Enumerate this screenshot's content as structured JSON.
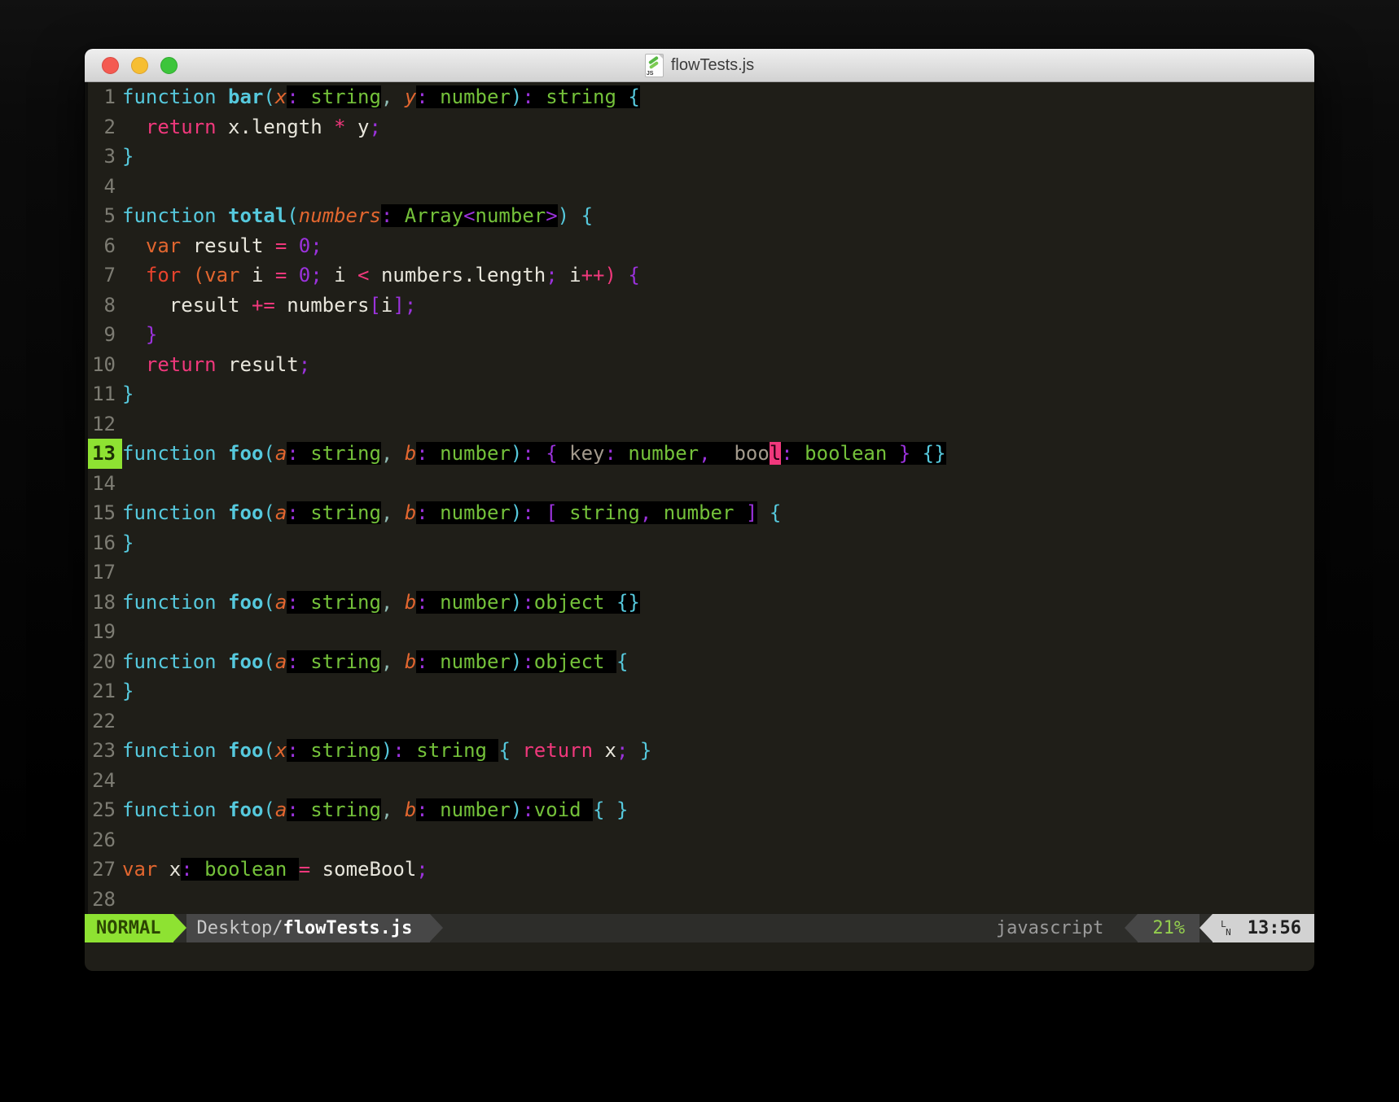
{
  "window": {
    "title": "flowTests.js"
  },
  "colors": {
    "code_background": "#1f1e18",
    "annotation_background": "#000000",
    "keyword_cyan": "#56c9dd",
    "type_green": "#74c13a",
    "param_orange": "#e2662f",
    "operator_pink": "#f0387c",
    "punct_purple": "#9b32dc",
    "identifier_white": "#e8e6dc",
    "mode_green": "#8ee232",
    "cursor_pink": "#f0387c"
  },
  "editor": {
    "current_line": 13,
    "lines": [
      {
        "n": 1,
        "toks": [
          [
            "cy",
            "function "
          ],
          [
            "cyb",
            "bar"
          ],
          [
            "cy",
            "("
          ],
          [
            "ori",
            "x"
          ],
          [
            "pu",
            ":",
            1
          ],
          [
            "gr",
            " string",
            1
          ],
          [
            "cm",
            ","
          ],
          [
            "wh",
            " "
          ],
          [
            "ori",
            "y"
          ],
          [
            "pu",
            ":",
            1
          ],
          [
            "gr",
            " number",
            1
          ],
          [
            "cy",
            ")",
            1
          ],
          [
            "pu",
            ":",
            1
          ],
          [
            "gr",
            " string",
            1
          ],
          [
            "cy",
            " {",
            1
          ]
        ]
      },
      {
        "n": 2,
        "toks": [
          [
            "pk",
            "  return"
          ],
          [
            "wh",
            " x.length"
          ],
          [
            "pk",
            " *"
          ],
          [
            "wh",
            " y"
          ],
          [
            "pu",
            ";"
          ]
        ]
      },
      {
        "n": 3,
        "toks": [
          [
            "cy",
            "}"
          ]
        ]
      },
      {
        "n": 4,
        "toks": []
      },
      {
        "n": 5,
        "toks": [
          [
            "cy",
            "function "
          ],
          [
            "cyb",
            "total"
          ],
          [
            "cy",
            "("
          ],
          [
            "ori",
            "numbers"
          ],
          [
            "pu",
            ":",
            1
          ],
          [
            "gr",
            " Array",
            1
          ],
          [
            "pu",
            "<",
            1
          ],
          [
            "gr",
            "number",
            1
          ],
          [
            "pu",
            ">",
            1
          ],
          [
            "cy",
            ") {"
          ]
        ]
      },
      {
        "n": 6,
        "toks": [
          [
            "or",
            "  var"
          ],
          [
            "wh",
            " result"
          ],
          [
            "pk",
            " ="
          ],
          [
            "pu",
            " 0;"
          ]
        ]
      },
      {
        "n": 7,
        "toks": [
          [
            "rd",
            "  for"
          ],
          [
            "or",
            " ("
          ],
          [
            "or",
            "var"
          ],
          [
            "wh",
            " i"
          ],
          [
            "pk",
            " ="
          ],
          [
            "pu",
            " 0;"
          ],
          [
            "wh",
            " i"
          ],
          [
            "pk",
            " <"
          ],
          [
            "wh",
            " numbers.length"
          ],
          [
            "pu",
            ";"
          ],
          [
            "wh",
            " i"
          ],
          [
            "pk",
            "++"
          ],
          [
            "pk",
            ")"
          ],
          [
            "pu",
            " {"
          ]
        ]
      },
      {
        "n": 8,
        "toks": [
          [
            "wh",
            "    result"
          ],
          [
            "pk",
            " +="
          ],
          [
            "wh",
            " numbers"
          ],
          [
            "pu",
            "["
          ],
          [
            "wh",
            "i"
          ],
          [
            "pu",
            "];"
          ]
        ]
      },
      {
        "n": 9,
        "toks": [
          [
            "pu",
            "  }"
          ]
        ]
      },
      {
        "n": 10,
        "toks": [
          [
            "pk",
            "  return"
          ],
          [
            "wh",
            " result"
          ],
          [
            "pu",
            ";"
          ]
        ]
      },
      {
        "n": 11,
        "toks": [
          [
            "cy",
            "}"
          ]
        ]
      },
      {
        "n": 12,
        "toks": []
      },
      {
        "n": 13,
        "toks": [
          [
            "cy",
            "function "
          ],
          [
            "cyb",
            "foo"
          ],
          [
            "cy",
            "("
          ],
          [
            "ori",
            "a"
          ],
          [
            "pu",
            ":",
            1
          ],
          [
            "gr",
            " string",
            1
          ],
          [
            "cm",
            ","
          ],
          [
            "wh",
            " "
          ],
          [
            "ori",
            "b"
          ],
          [
            "pu",
            ":",
            1
          ],
          [
            "gr",
            " number",
            1
          ],
          [
            "cy",
            ")",
            1
          ],
          [
            "pu",
            ":",
            1
          ],
          [
            "pu",
            " {",
            1
          ],
          [
            "gy",
            " key",
            1
          ],
          [
            "pu",
            ":",
            1
          ],
          [
            "gr",
            " number",
            1
          ],
          [
            "pu",
            ",",
            1
          ],
          [
            "gy",
            "  boo",
            1
          ],
          [
            "cur",
            "l"
          ],
          [
            "pu",
            ":",
            1
          ],
          [
            "gr",
            " boolean",
            1
          ],
          [
            "pu",
            " }",
            1
          ],
          [
            "wh",
            " ",
            1
          ],
          [
            "cy",
            "{}",
            1
          ]
        ]
      },
      {
        "n": 14,
        "toks": []
      },
      {
        "n": 15,
        "toks": [
          [
            "cy",
            "function "
          ],
          [
            "cyb",
            "foo"
          ],
          [
            "cy",
            "("
          ],
          [
            "ori",
            "a"
          ],
          [
            "pu",
            ":",
            1
          ],
          [
            "gr",
            " string",
            1
          ],
          [
            "cm",
            ","
          ],
          [
            "wh",
            " "
          ],
          [
            "ori",
            "b"
          ],
          [
            "pu",
            ":",
            1
          ],
          [
            "gr",
            " number",
            1
          ],
          [
            "cy",
            ")",
            1
          ],
          [
            "pu",
            ":",
            1
          ],
          [
            "pu",
            " [",
            1
          ],
          [
            "gr",
            " string",
            1
          ],
          [
            "pu",
            ",",
            1
          ],
          [
            "gr",
            " number",
            1
          ],
          [
            "pu",
            " ]",
            1
          ],
          [
            "cy",
            " {"
          ]
        ]
      },
      {
        "n": 16,
        "toks": [
          [
            "cy",
            "}"
          ]
        ]
      },
      {
        "n": 17,
        "toks": []
      },
      {
        "n": 18,
        "toks": [
          [
            "cy",
            "function "
          ],
          [
            "cyb",
            "foo"
          ],
          [
            "cy",
            "("
          ],
          [
            "ori",
            "a"
          ],
          [
            "pu",
            ":",
            1
          ],
          [
            "gr",
            " string",
            1
          ],
          [
            "cm",
            ","
          ],
          [
            "wh",
            " "
          ],
          [
            "ori",
            "b"
          ],
          [
            "pu",
            ":",
            1
          ],
          [
            "gr",
            " number",
            1
          ],
          [
            "cy",
            ")",
            1
          ],
          [
            "pu",
            ":",
            1
          ],
          [
            "gr",
            "object",
            1
          ],
          [
            "wh",
            " ",
            1
          ],
          [
            "cy",
            "{}",
            1
          ]
        ]
      },
      {
        "n": 19,
        "toks": []
      },
      {
        "n": 20,
        "toks": [
          [
            "cy",
            "function "
          ],
          [
            "cyb",
            "foo"
          ],
          [
            "cy",
            "("
          ],
          [
            "ori",
            "a"
          ],
          [
            "pu",
            ":",
            1
          ],
          [
            "gr",
            " string",
            1
          ],
          [
            "cm",
            ","
          ],
          [
            "wh",
            " "
          ],
          [
            "ori",
            "b"
          ],
          [
            "pu",
            ":",
            1
          ],
          [
            "gr",
            " number",
            1
          ],
          [
            "cy",
            ")",
            1
          ],
          [
            "pu",
            ":",
            1
          ],
          [
            "gr",
            "object",
            1
          ],
          [
            "wh",
            " ",
            1
          ],
          [
            "cy",
            "{"
          ]
        ]
      },
      {
        "n": 21,
        "toks": [
          [
            "cy",
            "}"
          ]
        ]
      },
      {
        "n": 22,
        "toks": []
      },
      {
        "n": 23,
        "toks": [
          [
            "cy",
            "function "
          ],
          [
            "cyb",
            "foo"
          ],
          [
            "cy",
            "("
          ],
          [
            "ori",
            "x"
          ],
          [
            "pu",
            ":",
            1
          ],
          [
            "gr",
            " string",
            1
          ],
          [
            "cy",
            ")",
            1
          ],
          [
            "pu",
            ":",
            1
          ],
          [
            "gr",
            " string",
            1
          ],
          [
            "wh",
            " ",
            1
          ],
          [
            "cy",
            "{"
          ],
          [
            "pk",
            " return"
          ],
          [
            "wh",
            " x"
          ],
          [
            "pu",
            ";"
          ],
          [
            "cy",
            " }"
          ]
        ]
      },
      {
        "n": 24,
        "toks": []
      },
      {
        "n": 25,
        "toks": [
          [
            "cy",
            "function "
          ],
          [
            "cyb",
            "foo"
          ],
          [
            "cy",
            "("
          ],
          [
            "ori",
            "a"
          ],
          [
            "pu",
            ":",
            1
          ],
          [
            "gr",
            " string",
            1
          ],
          [
            "cm",
            ","
          ],
          [
            "wh",
            " "
          ],
          [
            "ori",
            "b"
          ],
          [
            "pu",
            ":",
            1
          ],
          [
            "gr",
            " number",
            1
          ],
          [
            "cy",
            ")",
            1
          ],
          [
            "pu",
            ":",
            1
          ],
          [
            "gr",
            "void",
            1
          ],
          [
            "wh",
            " ",
            1
          ],
          [
            "cy",
            "{ }"
          ]
        ]
      },
      {
        "n": 26,
        "toks": []
      },
      {
        "n": 27,
        "toks": [
          [
            "or",
            "var"
          ],
          [
            "wh",
            " x"
          ],
          [
            "pu",
            ":",
            1
          ],
          [
            "gr",
            " boolean",
            1
          ],
          [
            "wh",
            " ",
            1
          ],
          [
            "pk",
            "="
          ],
          [
            "wh",
            " someBool"
          ],
          [
            "pu",
            ";"
          ]
        ]
      },
      {
        "n": 28,
        "toks": []
      }
    ]
  },
  "statusbar": {
    "mode": "NORMAL",
    "path_dir": "Desktop/",
    "path_file": "flowTests.js",
    "filetype": "javascript",
    "scroll_percent": "21%",
    "linenr_symbol_top": "L",
    "linenr_symbol_bottom": "N",
    "line_col": "13:56"
  }
}
